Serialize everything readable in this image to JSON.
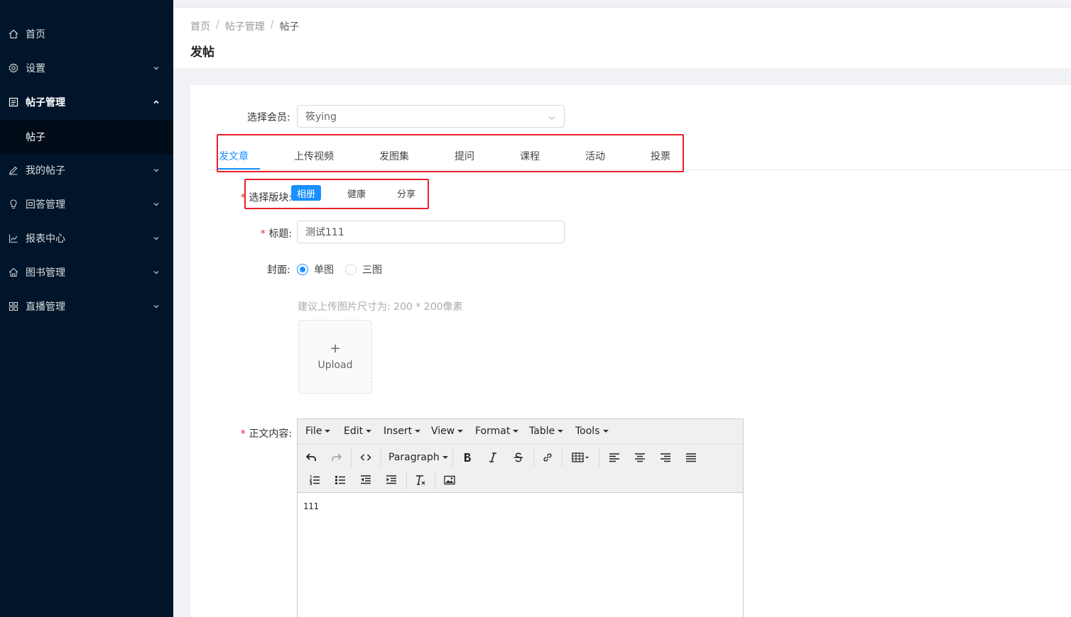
{
  "sidebar": {
    "items": [
      {
        "label": "首页",
        "icon": "home-icon"
      },
      {
        "label": "设置",
        "icon": "gear-icon"
      },
      {
        "label": "帖子管理",
        "icon": "post-icon"
      },
      {
        "label": "我的帖子",
        "icon": "edit-icon"
      },
      {
        "label": "回答管理",
        "icon": "bulb-icon"
      },
      {
        "label": "报表中心",
        "icon": "line-chart-icon"
      },
      {
        "label": "图书管理",
        "icon": "book-home-icon"
      },
      {
        "label": "直播管理",
        "icon": "grid-icon"
      }
    ],
    "sub_item": "帖子"
  },
  "breadcrumb": [
    "首页",
    "帖子管理",
    "帖子"
  ],
  "page_title": "发帖",
  "form": {
    "member_label": "选择会员:",
    "member_value": "筱ying",
    "tabs": [
      "发文章",
      "上传视频",
      "发图集",
      "提问",
      "课程",
      "活动",
      "投票"
    ],
    "section_label": "选择版块:",
    "sections": [
      "相册",
      "健康",
      "分享"
    ],
    "title_label": "标题:",
    "title_value": "测试111",
    "cover_label": "封面:",
    "cover_options": [
      "单图",
      "三图"
    ],
    "cover_selected": "单图",
    "upload_hint": "建议上传图片尺寸为: 200 * 200像素",
    "upload_text": "Upload",
    "body_label": "正文内容:"
  },
  "editor": {
    "menus": [
      "File",
      "Edit",
      "Insert",
      "View",
      "Format",
      "Table",
      "Tools"
    ],
    "block_format": "Paragraph",
    "content": "111"
  },
  "colors": {
    "sidebar_bg": "#001529",
    "accent": "#1890ff",
    "highlight_box": "#e8202a",
    "required": "#f5222d"
  }
}
